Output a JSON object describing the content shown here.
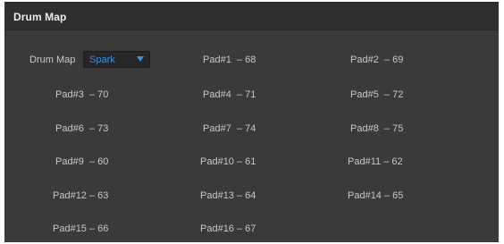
{
  "panel": {
    "title": "Drum Map"
  },
  "kit": {
    "label": "Drum Map",
    "selected": "Spark",
    "arrow_icon": "triangle-down-icon",
    "accent_color": "#3d8fe6"
  },
  "pads": [
    {
      "label": "Pad#1  – 68"
    },
    {
      "label": "Pad#2  – 69"
    },
    {
      "label": "Pad#3  – 70"
    },
    {
      "label": "Pad#4  – 71"
    },
    {
      "label": "Pad#5  – 72"
    },
    {
      "label": "Pad#6  – 73"
    },
    {
      "label": "Pad#7  – 74"
    },
    {
      "label": "Pad#8  – 75"
    },
    {
      "label": "Pad#9  – 60"
    },
    {
      "label": "Pad#10 – 61"
    },
    {
      "label": "Pad#11 – 62"
    },
    {
      "label": "Pad#12 – 63"
    },
    {
      "label": "Pad#13 – 64"
    },
    {
      "label": "Pad#14 – 65"
    },
    {
      "label": "Pad#15 – 66"
    },
    {
      "label": "Pad#16 – 67"
    }
  ]
}
